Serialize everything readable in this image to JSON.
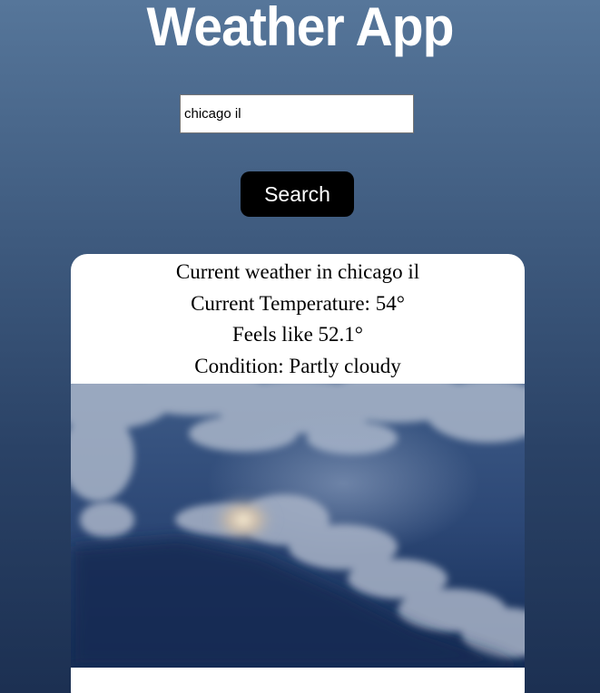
{
  "app": {
    "title": "Weather App"
  },
  "search": {
    "value": "chicago il",
    "button_label": "Search"
  },
  "weather": {
    "location_line": "Current weather in chicago il",
    "temperature_line": "Current Temperature: 54°",
    "feels_like_line": "Feels like 52.1°",
    "condition_line": "Condition: Partly cloudy"
  },
  "image": {
    "description": "partly-cloudy-sky"
  }
}
